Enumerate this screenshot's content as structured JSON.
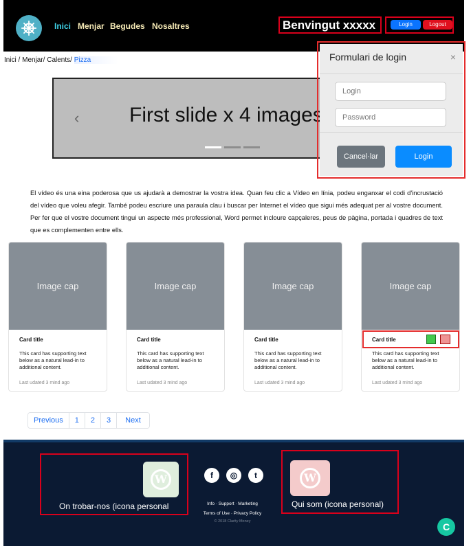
{
  "nav": {
    "links": [
      "Inici",
      "Menjar",
      "Begudes",
      "Nosaltres"
    ],
    "welcome": "Benvingut xxxxx",
    "login_label": "Login",
    "logout_label": "Logout"
  },
  "breadcrumb": {
    "path": "Inici / Menjar/ Calents/",
    "current": "Pizza"
  },
  "carousel": {
    "caption": "First slide x 4 images",
    "prev_glyph": "‹",
    "active_index": 1,
    "indicator_count": 3
  },
  "login_modal": {
    "title": "Formulari de login",
    "close_glyph": "×",
    "user_placeholder": "Login",
    "password_placeholder": "Password",
    "cancel_label": "Cancel·lar",
    "submit_label": "Login"
  },
  "intro_text": "El vídeo és una eina poderosa que us ajudarà a demostrar la vostra idea. Quan feu clic a Vídeo en línia, podeu enganxar el codi d'incrustació del vídeo que voleu afegir. També podeu escriure una paraula clau i buscar per Internet el vídeo que sigui més adequat per al vostre document. Per fer que el vostre document tingui un aspecte més professional, Word permet incloure capçaleres, peus de pàgina, portada i quadres de text que es complementen entre ells.",
  "cards": [
    {
      "image_label": "Image cap",
      "title": "Card title",
      "text": "This card has supporting text below as a natural lead-in to additional content.",
      "updated": "Last udated 3 mind ago"
    },
    {
      "image_label": "Image cap",
      "title": "Card title",
      "text": "This card has supporting text below as a natural lead-in to additional content.",
      "updated": "Last udated 3 mind ago"
    },
    {
      "image_label": "Image cap",
      "title": "Card title",
      "text": "This card has supporting text below as a natural lead-in to additional content.",
      "updated": "Last udated 3 mind ago"
    },
    {
      "image_label": "Image cap",
      "title": "Card title",
      "text": "This card has supporting text below as a natural lead-in to additional content.",
      "updated": "Last udated 3 mind ago"
    }
  ],
  "pagination": {
    "previous": "Previous",
    "pages": [
      "1",
      "2",
      "3"
    ],
    "next": "Next"
  },
  "footer": {
    "left_label": "On trobar-nos (icona personal",
    "right_label": "Qui som (icona personal)",
    "links_line1": "Info · Support · Marketing",
    "links_line2": "Terms of Use · Privacy Policy",
    "copyright": "© 2018 Clarity Money",
    "social": [
      "f",
      "◎",
      "t"
    ]
  },
  "colors": {
    "nav_bg": "#000000",
    "nav_active": "#3fd3e8",
    "login_blue": "#0b74ff",
    "logout_red": "#e0101e",
    "highlight_red": "#e42c2c",
    "footer_bg": "#0b1a33",
    "card_img": "#868e96"
  }
}
